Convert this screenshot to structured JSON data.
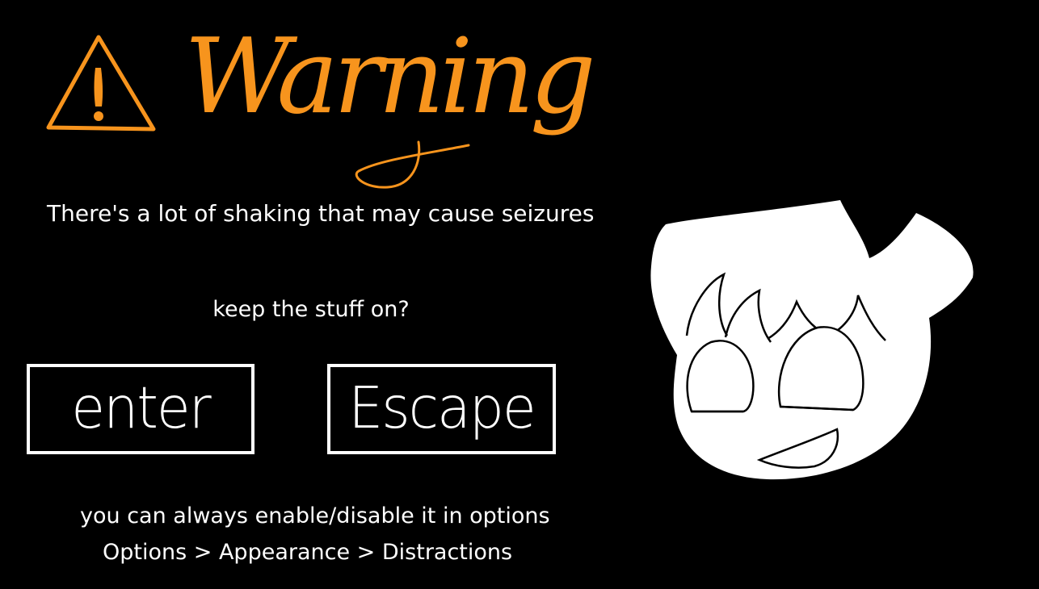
{
  "warning": {
    "title": "Warning",
    "icon": "warning-triangle-icon",
    "accent_color": "#f7941d"
  },
  "message": "There's a lot of shaking that may cause seizures",
  "prompt": "keep the stuff on?",
  "buttons": {
    "enter_label": "enter",
    "escape_label": "Escape"
  },
  "footer": {
    "note": "you can always enable/disable it in options",
    "path": "Options > Appearance > Distractions"
  },
  "mascot": "character-face-icon"
}
